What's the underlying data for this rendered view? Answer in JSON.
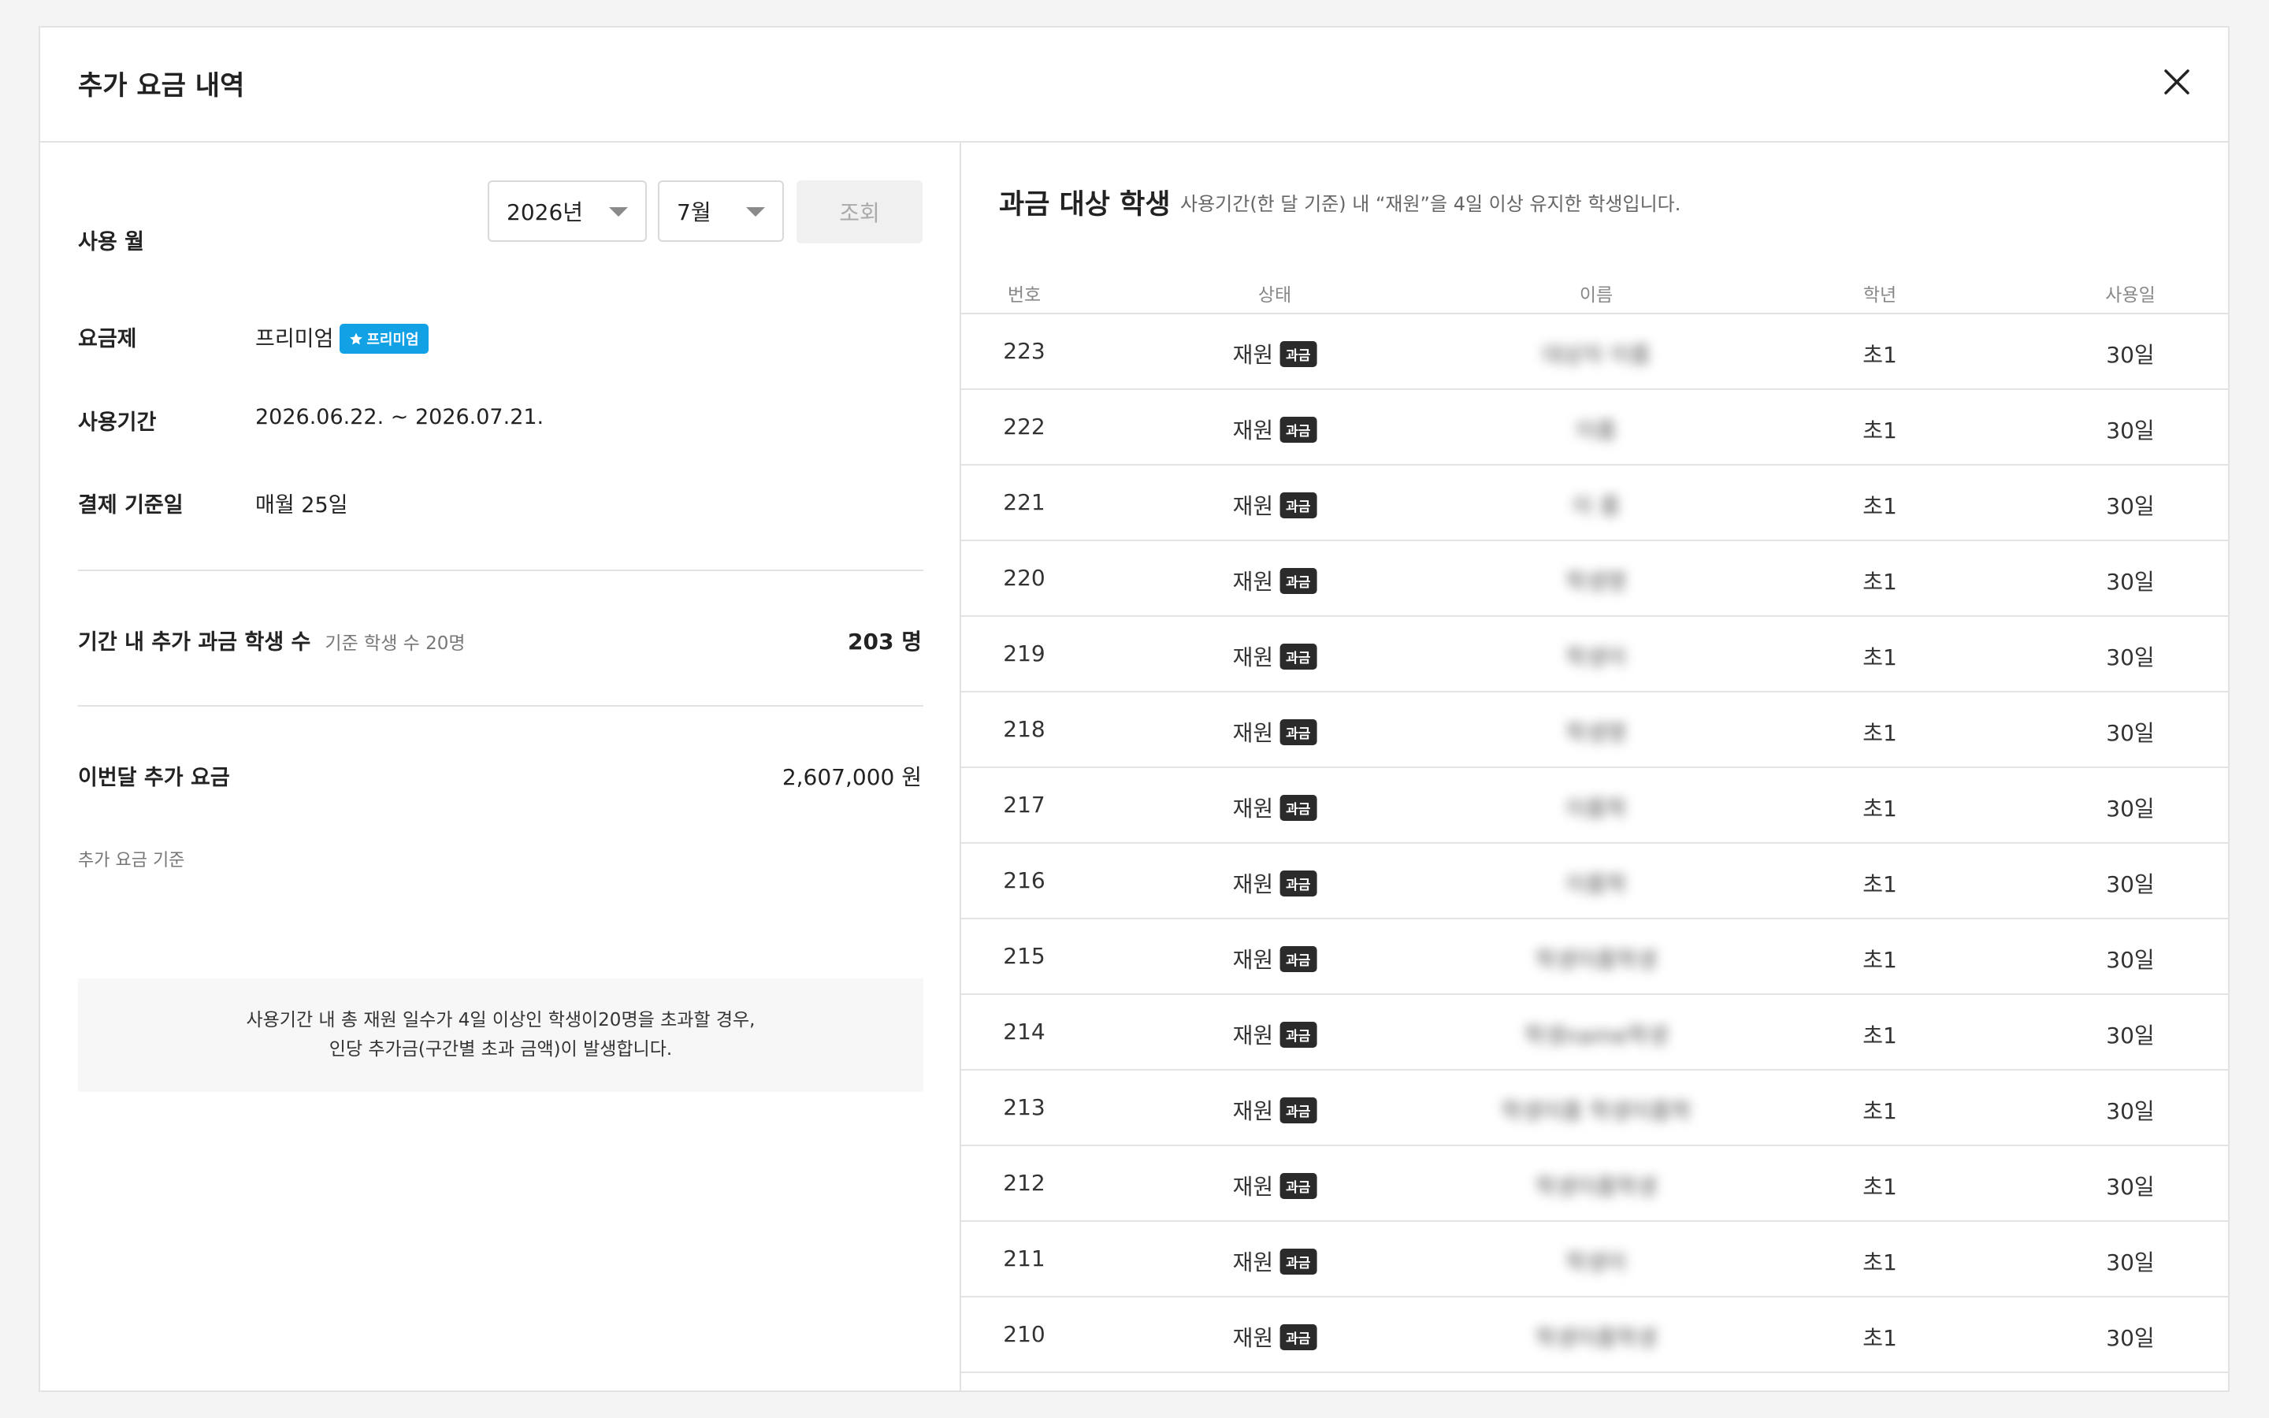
{
  "modal": {
    "title": "추가 요금 내역",
    "close_icon": "close-icon"
  },
  "left": {
    "usage_month_label": "사용 월",
    "year_select": {
      "value": "2026년"
    },
    "month_select": {
      "value": "7월"
    },
    "query_button": "조회",
    "plan_label": "요금제",
    "plan_value": "프리미엄",
    "plan_badge": "프리미엄",
    "plan_badge_icon": "star-icon",
    "period_label": "사용기간",
    "period_value": "2026.06.22. ~ 2026.07.21.",
    "billing_day_label": "결제 기준일",
    "billing_day_value": "매월 25일",
    "extra_students_label": "기간 내 추가 과금 학생 수",
    "extra_students_note": "기준 학생 수 20명",
    "extra_students_value": "203 명",
    "monthly_fee_label": "이번달 추가 요금",
    "monthly_fee_value": "2,607,000 원",
    "criteria_label": "추가 요금 기준",
    "criteria_line1": "사용기간 내 총 재원 일수가 4일 이상인 학생이20명을 초과할 경우,",
    "criteria_line2": "인당 추가금(구간별 초과 금액)이 발생합니다."
  },
  "right": {
    "title": "과금 대상 학생",
    "description": "사용기간(한 달 기준) 내 “재원”을 4일 이상 유지한 학생입니다.",
    "columns": [
      "번호",
      "상태",
      "이름",
      "학년",
      "사용일"
    ],
    "status_badge": "과금",
    "rows": [
      {
        "no": "223",
        "status": "재원",
        "name": "대상자 이름",
        "grade": "초1",
        "days": "30일"
      },
      {
        "no": "222",
        "status": "재원",
        "name": "이름",
        "grade": "초1",
        "days": "30일"
      },
      {
        "no": "221",
        "status": "재원",
        "name": "이 름",
        "grade": "초1",
        "days": "30일"
      },
      {
        "no": "220",
        "status": "재원",
        "name": "학생명",
        "grade": "초1",
        "days": "30일"
      },
      {
        "no": "219",
        "status": "재원",
        "name": "학생이",
        "grade": "초1",
        "days": "30일"
      },
      {
        "no": "218",
        "status": "재원",
        "name": "학생명",
        "grade": "초1",
        "days": "30일"
      },
      {
        "no": "217",
        "status": "재원",
        "name": "이름학",
        "grade": "초1",
        "days": "30일"
      },
      {
        "no": "216",
        "status": "재원",
        "name": "이름학",
        "grade": "초1",
        "days": "30일"
      },
      {
        "no": "215",
        "status": "재원",
        "name": "학생이름학생",
        "grade": "초1",
        "days": "30일"
      },
      {
        "no": "214",
        "status": "재원",
        "name": "학생name학생",
        "grade": "초1",
        "days": "30일"
      },
      {
        "no": "213",
        "status": "재원",
        "name": "학생이름 학생이름학",
        "grade": "초1",
        "days": "30일"
      },
      {
        "no": "212",
        "status": "재원",
        "name": "학생이름학생",
        "grade": "초1",
        "days": "30일"
      },
      {
        "no": "211",
        "status": "재원",
        "name": "학생이",
        "grade": "초1",
        "days": "30일"
      },
      {
        "no": "210",
        "status": "재원",
        "name": "학생이름학생",
        "grade": "초1",
        "days": "30일"
      }
    ]
  }
}
